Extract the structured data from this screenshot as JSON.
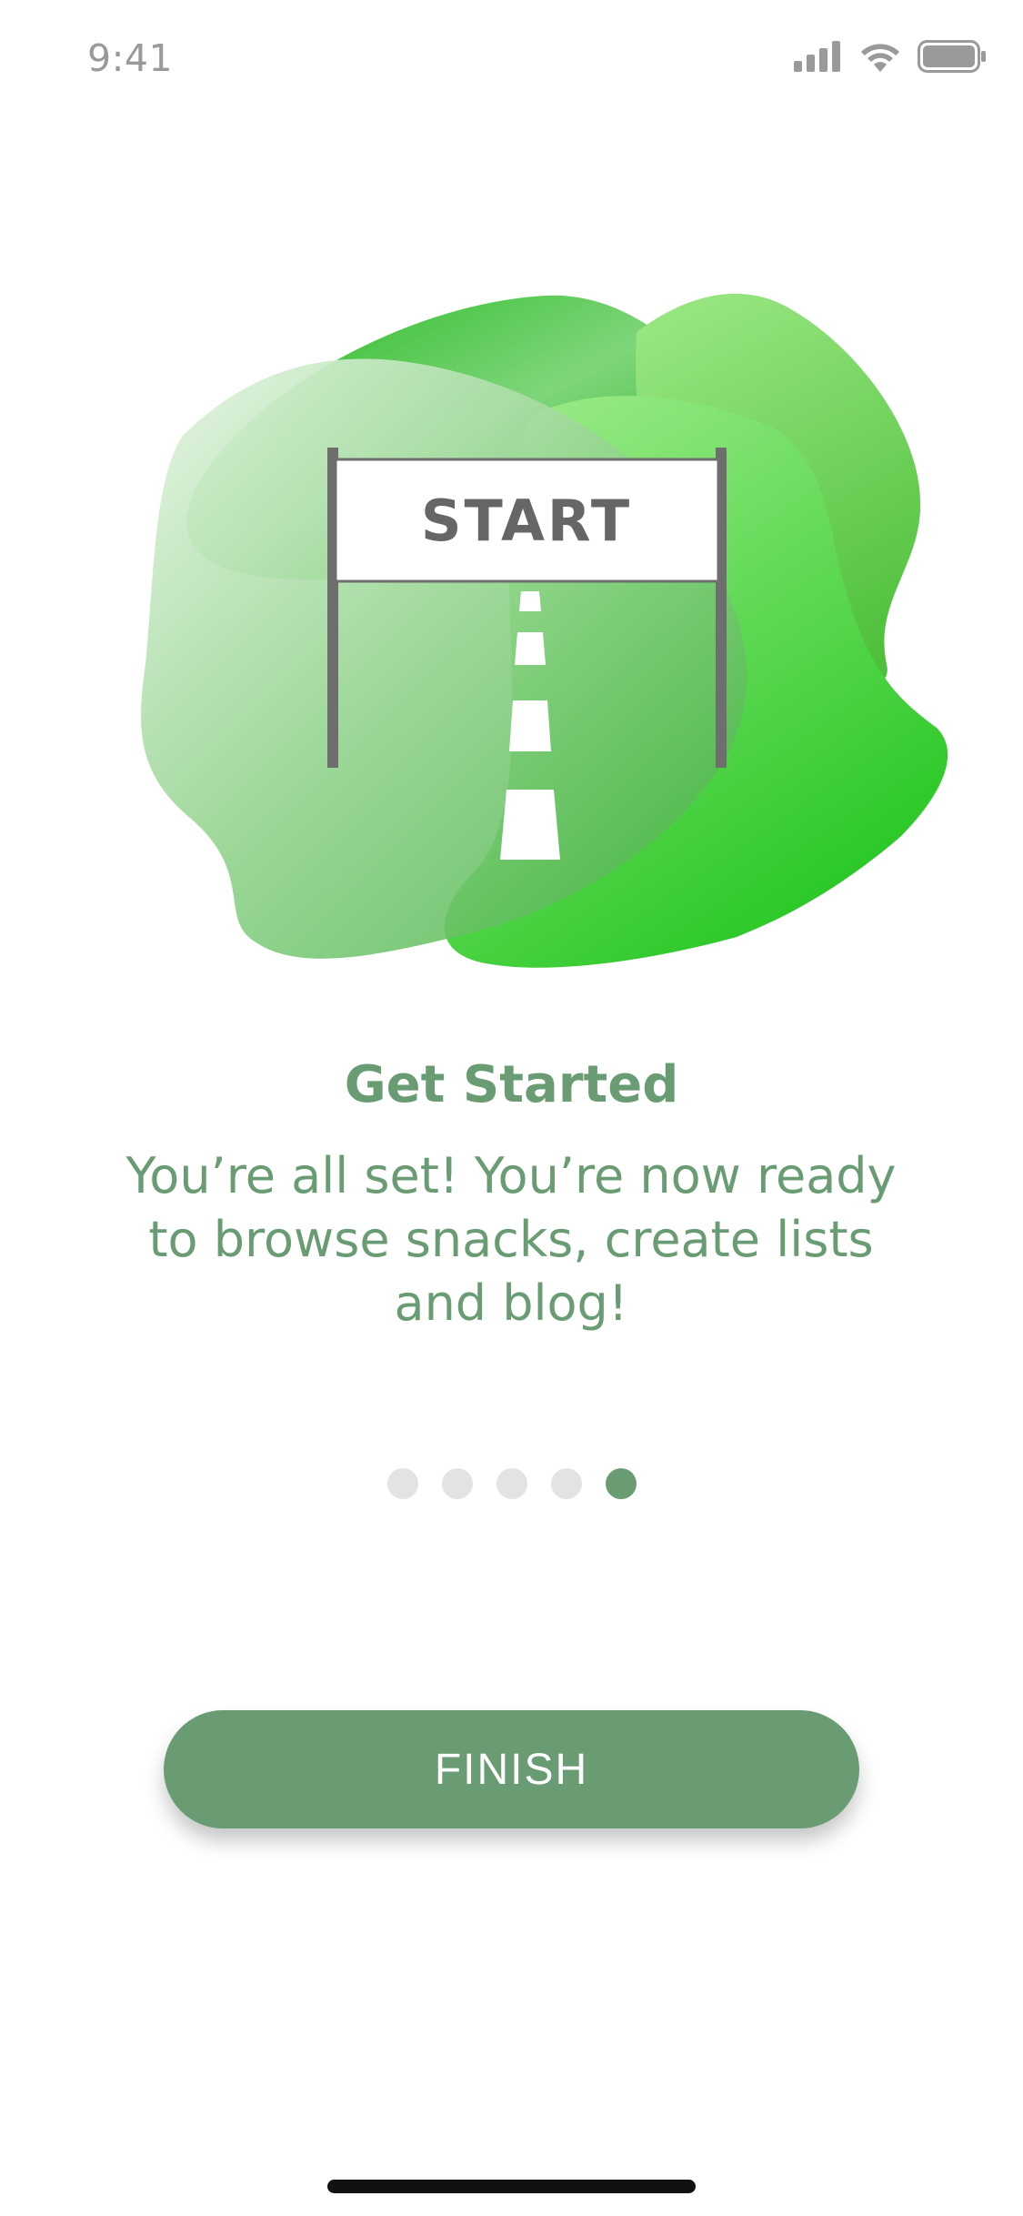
{
  "status_bar": {
    "time": "9:41",
    "icons": [
      "cellular-signal-icon",
      "wifi-icon",
      "battery-icon"
    ]
  },
  "illustration": {
    "sign_text": "START"
  },
  "onboarding": {
    "title": "Get Started",
    "description": "You’re all set! You’re now ready to browse snacks, create lists and blog!",
    "page_count": 5,
    "current_page": 5
  },
  "actions": {
    "finish_label": "FINISH"
  },
  "colors": {
    "accent": "#6a9c74",
    "dot_inactive": "#e3e3e3"
  }
}
